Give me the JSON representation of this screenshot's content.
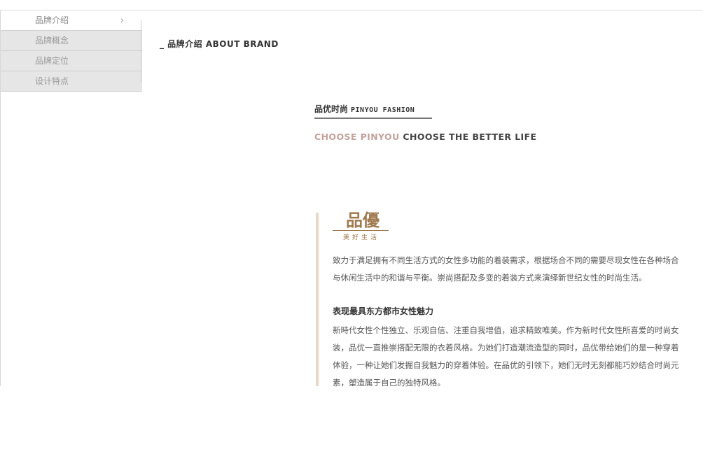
{
  "sidebar": {
    "items": [
      {
        "label": "品牌介绍"
      },
      {
        "label": "品牌概念"
      },
      {
        "label": "品牌定位"
      },
      {
        "label": "设计特点"
      }
    ]
  },
  "section": {
    "title": "_ 品牌介绍 ABOUT BRAND"
  },
  "brand": {
    "cn": "品优时尚",
    "en": "PINYOU FASHION"
  },
  "tagline": {
    "accent": "CHOOSE PINYOU",
    "rest": "CHOOSE THE BETTER LIFE"
  },
  "logo": {
    "cn": "品優",
    "sub": "美好生活"
  },
  "content": {
    "p1_line1": "致力于满足拥有不同生活方式的女性多功能的着装需求，根据场合不同的需要尽现女性在各种场合",
    "p1_line2": "与休闲生活中的和谐与平衡。崇尚搭配及多变的着装方式来演绎新世纪女性的时尚生活。",
    "subheading": "表现最具东方都市女性魅力",
    "p2_line1": "新時代女性个性独立、乐观自信、注重自我增值，追求精致唯美。作为新时代女性所喜爱的时尚女",
    "p2_line2": "装，品优一直推崇搭配无限的衣着风格。为她们打造潮流造型的同时，品优带给她们的是一种穿着",
    "p2_line3": "体验，一种让她们发掘自我魅力的穿着体验。在品优的引领下，她们无时无刻都能巧妙结合时尚元",
    "p2_line4": "素，塑造属于自己的独特风格。"
  },
  "colors": {
    "accent": "#c2a29a",
    "logo": "#a07a4f",
    "bar": "#e8d8c8"
  }
}
